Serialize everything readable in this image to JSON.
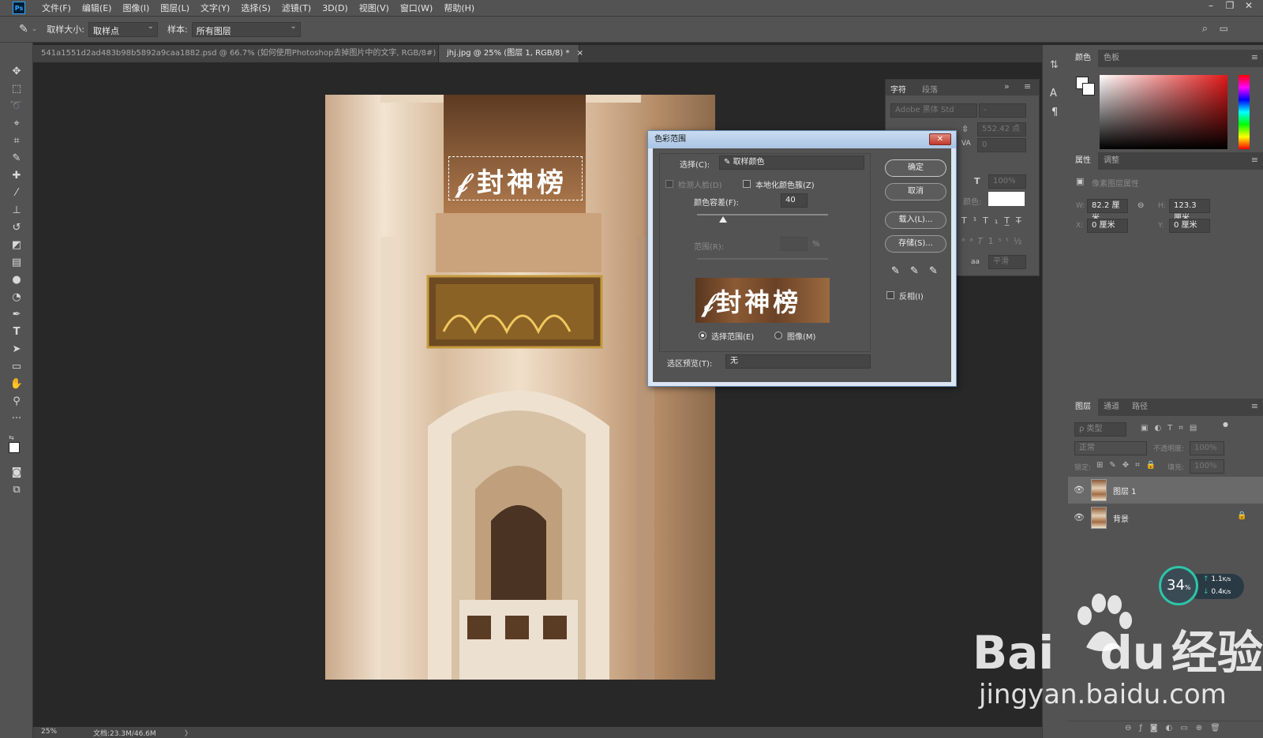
{
  "app": {
    "logo": "Ps",
    "menu": [
      "文件(F)",
      "编辑(E)",
      "图像(I)",
      "图层(L)",
      "文字(Y)",
      "选择(S)",
      "滤镜(T)",
      "3D(D)",
      "视图(V)",
      "窗口(W)",
      "帮助(H)"
    ]
  },
  "options_bar": {
    "sample_size_label": "取样大小:",
    "sample_size_value": "取样点",
    "sample_label": "样本:",
    "sample_value": "所有图层"
  },
  "tabs": [
    {
      "label": "541a1551d2ad483b98b5892a9caa1882.psd @ 66.7% (如何使用Photoshop去掉图片中的文字, RGB/8#) *",
      "close": "×"
    },
    {
      "label": "jhj.jpg @ 25% (图层 1, RGB/8) *",
      "close": "×"
    }
  ],
  "image": {
    "selected_text": "封神榜",
    "selected_text_prefix": "𝒻"
  },
  "status_bar": {
    "zoom": "25%",
    "doc_size": "文档:23.3M/46.6M",
    "arrow": "〉"
  },
  "char_panel": {
    "tabs": [
      "字符",
      "段落"
    ],
    "font": "Adobe 黑体 Std",
    "font_style": "-",
    "size": "552.42 点",
    "tracking": "0",
    "scale": "100%",
    "color_label": "颜色:",
    "antialias_label": "aa",
    "antialias_value": "平滑"
  },
  "dialog": {
    "title": "色彩范围",
    "select_label": "选择(C):",
    "select_value": "取样颜色",
    "detect_faces": "检测人脸(D)",
    "localized_clusters": "本地化颜色簇(Z)",
    "fuzziness_label": "颜色容差(F):",
    "fuzziness_value": "40",
    "fuzziness_fraction": 0.2,
    "range_label": "范围(R):",
    "range_unit": "%",
    "radio_selection": "选择范围(E)",
    "radio_image": "图像(M)",
    "preview_label": "选区预览(T):",
    "preview_value": "无",
    "btn_ok": "确定",
    "btn_cancel": "取消",
    "btn_load": "载入(L)...",
    "btn_save": "存储(S)...",
    "invert": "反相(I)",
    "close": "✕"
  },
  "right_panels": {
    "color_tabs": [
      "颜色",
      "色板"
    ],
    "props_tabs": [
      "属性",
      "调整"
    ],
    "props_title": "像素图层属性",
    "w_label": "W:",
    "w_value": "82.2 厘米",
    "h_label": "H:",
    "h_value": "123.3 厘米",
    "x_label": "X:",
    "x_value": "0 厘米",
    "y_label": "Y:",
    "y_value": "0 厘米",
    "layers_tabs": [
      "图层",
      "通道",
      "路径"
    ],
    "kind_placeholder": "ρ 类型",
    "blend_mode": "正常",
    "opacity_label": "不透明度:",
    "opacity_value": "100%",
    "lock_label": "锁定:",
    "fill_label": "填充:",
    "fill_value": "100%",
    "layers": [
      {
        "name": "图层 1",
        "selected": true
      },
      {
        "name": "背景",
        "selected": false
      }
    ]
  },
  "gauge": {
    "percent": "34",
    "percent_unit": "%",
    "up": "1.1",
    "down": "0.4",
    "unit": "K/s"
  },
  "watermark": {
    "brand": "Bai",
    "brand_du": "du",
    "brand_cn": "经验",
    "url": "jingyan.baidu.com"
  },
  "colors": {
    "accent_blue": "#31a8ff",
    "panel_bg": "#535353",
    "canvas_bg": "#282828",
    "dialog_frame": "#dbe6f3",
    "close_red": "#c0392b"
  }
}
